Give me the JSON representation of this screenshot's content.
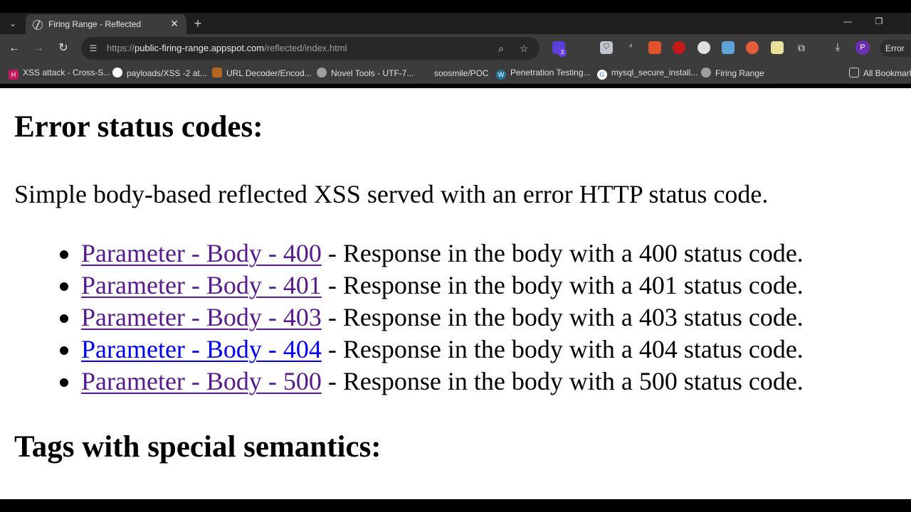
{
  "tab": {
    "title": "Firing Range - Reflected"
  },
  "toolbar": {
    "url_scheme": "https://",
    "url_host": "public-firing-range.appspot.com",
    "url_path": "/reflected/index.html",
    "extension_badge": "3",
    "profile_initial": "P",
    "error_chip": "Error"
  },
  "bookmarks": {
    "items": [
      {
        "label": "XSS attack - Cross-S...",
        "color": "#c2185b"
      },
      {
        "label": "payloads/XSS -2 at...",
        "color": "#ffffff"
      },
      {
        "label": "URL Decoder/Encod...",
        "color": "#b5651d"
      },
      {
        "label": "Novel Tools - UTF-7...",
        "color": "#9e9e9e"
      },
      {
        "label": "soosmile/POC",
        "color": "#3c3c3c"
      },
      {
        "label": "Penetration Testing...",
        "color": "#21759b"
      },
      {
        "label": "mysql_secure_install...",
        "color": "#ffffff"
      },
      {
        "label": "Firing Range",
        "color": "#9e9e9e"
      }
    ],
    "all_bookmarks": "All Bookmarks"
  },
  "page": {
    "heading_error": "Error status codes:",
    "description": "Simple body-based reflected XSS served with an error HTTP status code.",
    "items": [
      {
        "link": "Parameter - Body - 400",
        "text": " - Response in the body with a 400 status code.",
        "visited": true
      },
      {
        "link": "Parameter - Body - 401",
        "text": " - Response in the body with a 401 status code.",
        "visited": true
      },
      {
        "link": "Parameter - Body - 403",
        "text": " - Response in the body with a 403 status code.",
        "visited": true
      },
      {
        "link": "Parameter - Body - 404",
        "text": " - Response in the body with a 404 status code.",
        "visited": false
      },
      {
        "link": "Parameter - Body - 500",
        "text": " - Response in the body with a 500 status code.",
        "visited": true
      }
    ],
    "heading_tags": "Tags with special semantics:"
  },
  "colors": {
    "visited_link": "#551a8b",
    "unvisited_link": "#0000ee",
    "toolbar_bg": "#3c3c3c"
  }
}
